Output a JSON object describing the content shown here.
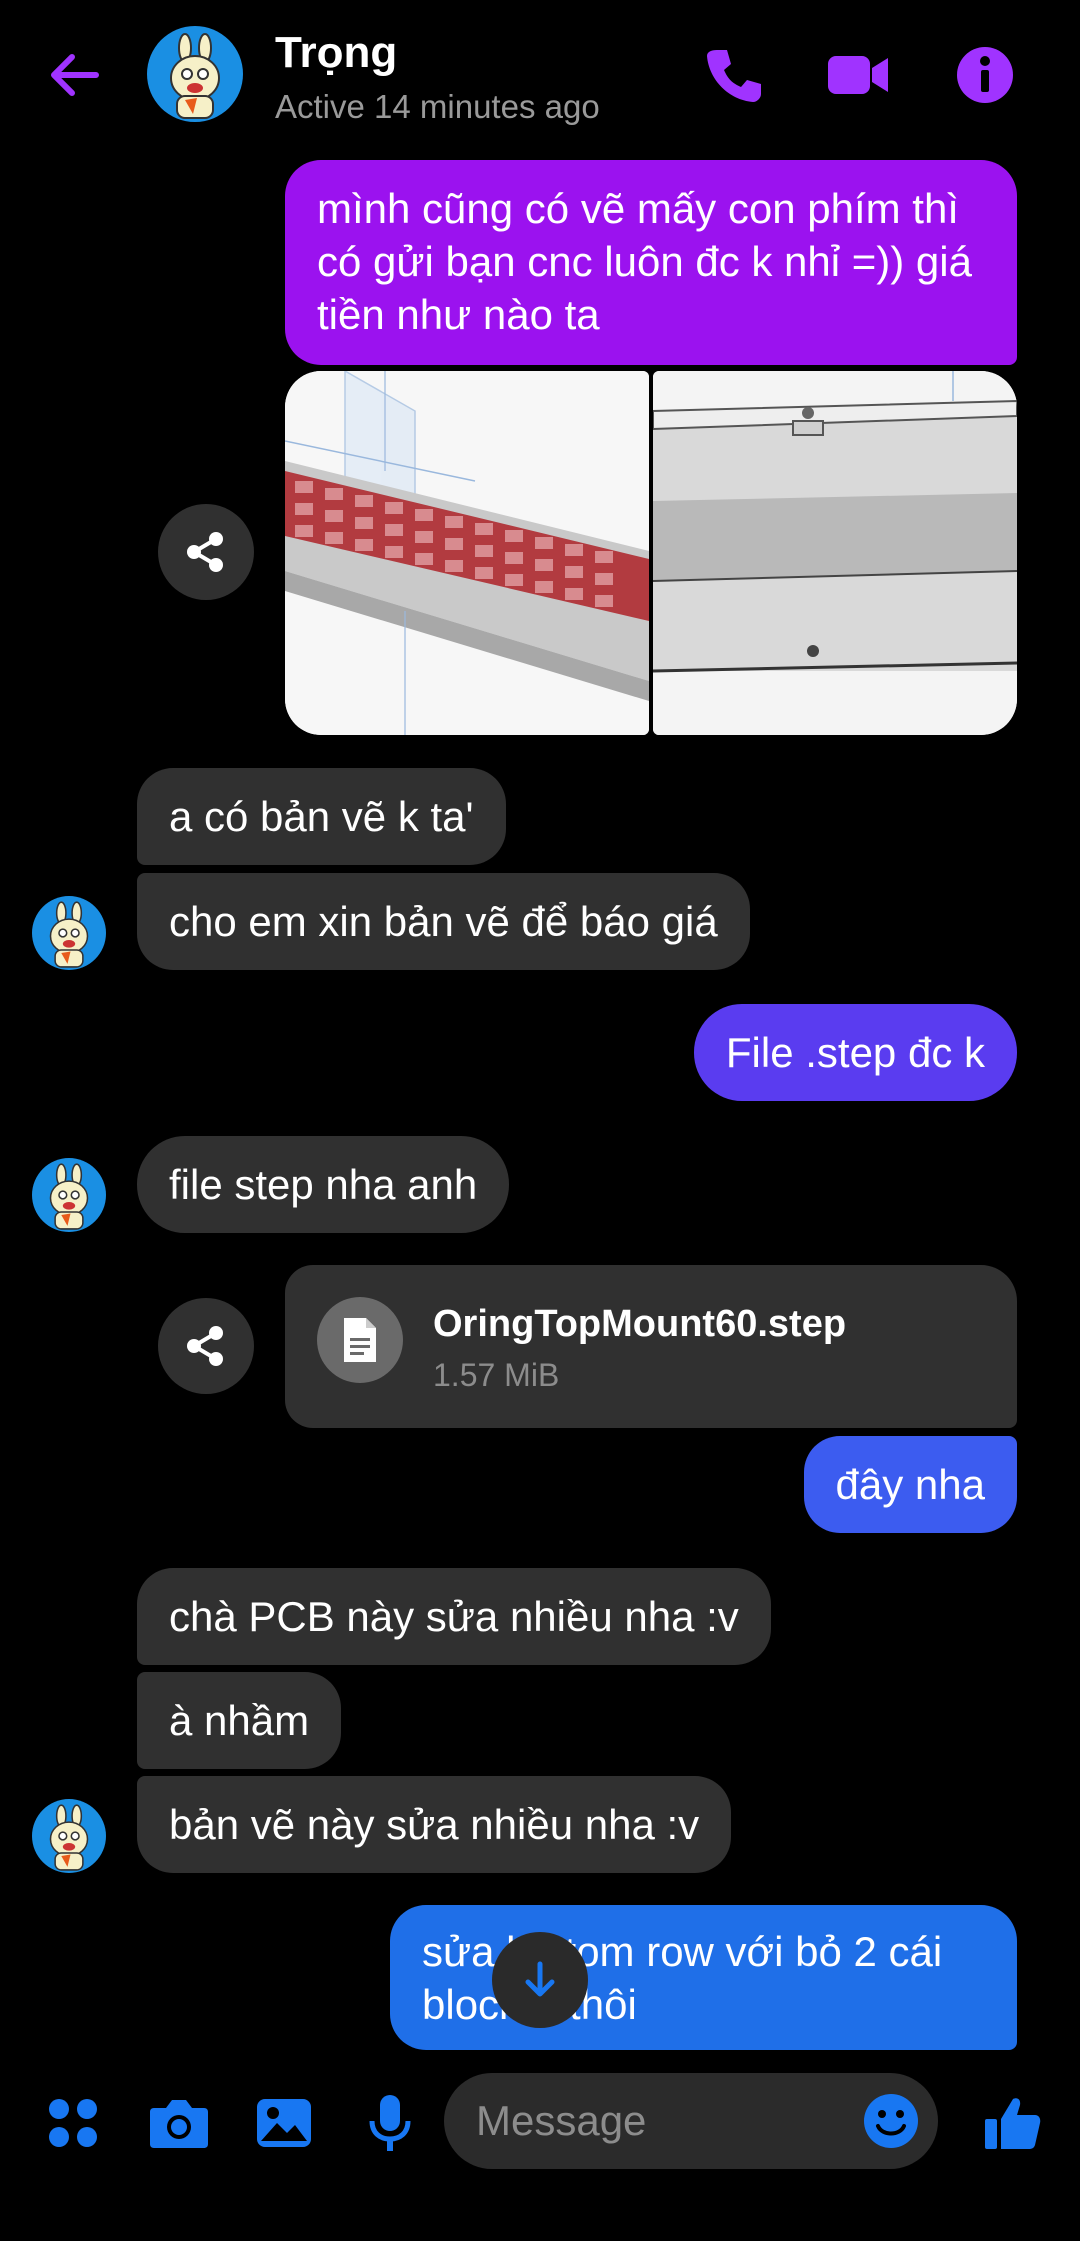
{
  "header": {
    "name": "Trọng",
    "status": "Active 14 minutes ago",
    "accent": "#a033ff"
  },
  "messages": [
    {
      "id": "m1",
      "dir": "out",
      "text": "mình cũng có vẽ mấy con phím thì có gửi bạn cnc luôn đc k nhỉ =)) giá tiền như nào ta",
      "color": "#9b12ef"
    },
    {
      "id": "m2",
      "dir": "in",
      "text": "a có bản vẽ k ta'"
    },
    {
      "id": "m3",
      "dir": "in",
      "text": "cho em xin bản vẽ để báo giá"
    },
    {
      "id": "m4",
      "dir": "out",
      "text": "File .step đc k",
      "color": "#5a3cf0"
    },
    {
      "id": "m5",
      "dir": "in",
      "text": "file step nha anh"
    },
    {
      "id": "m6",
      "dir": "out",
      "text": "đây nha",
      "color": "#3c5cf0"
    },
    {
      "id": "m7",
      "dir": "in",
      "text": "chà PCB này sửa nhiều nha :v"
    },
    {
      "id": "m8",
      "dir": "in",
      "text": "à nhầm"
    },
    {
      "id": "m9",
      "dir": "in",
      "text": "bản vẽ này sửa nhiều nha :v"
    },
    {
      "id": "m10",
      "dir": "out",
      "text": "sửa bottom row với bỏ 2 cái blocker thôi",
      "color": "#1f6fe8"
    }
  ],
  "attachment": {
    "file_name": "OringTopMount60.step",
    "file_size": "1.57 MiB"
  },
  "composer": {
    "placeholder": "Message",
    "icon_color": "#1877f2"
  },
  "icons": [
    "back-arrow-icon",
    "phone-icon",
    "video-icon",
    "info-icon",
    "share-icon",
    "file-icon",
    "arrow-down-icon",
    "apps-icon",
    "camera-icon",
    "gallery-icon",
    "mic-icon",
    "emoji-icon",
    "thumbs-up-icon"
  ]
}
